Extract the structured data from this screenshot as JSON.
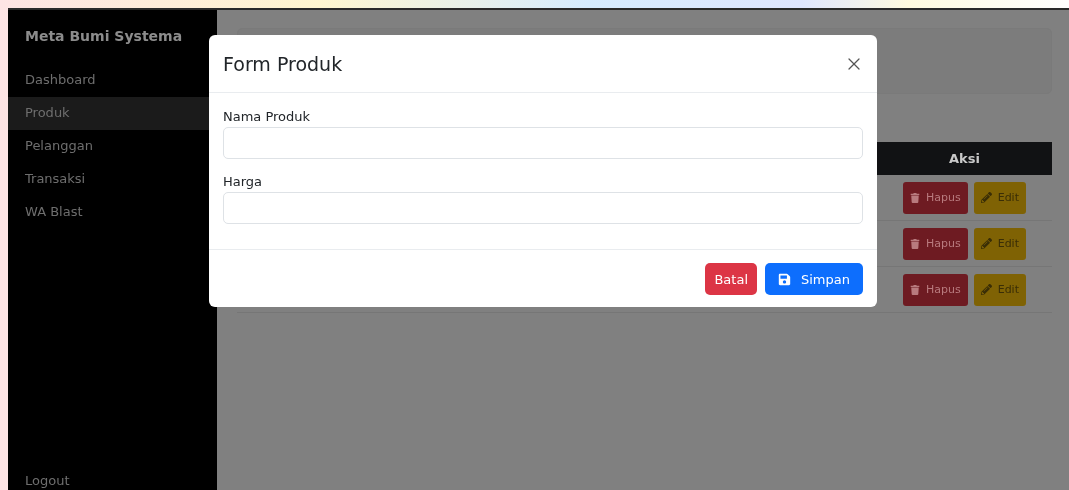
{
  "sidebar": {
    "title": "Meta Bumi Systema",
    "items": [
      {
        "label": "Dashboard",
        "selected": false
      },
      {
        "label": "Produk",
        "selected": true
      },
      {
        "label": "Pelanggan",
        "selected": false
      },
      {
        "label": "Transaksi",
        "selected": false
      },
      {
        "label": "WA Blast",
        "selected": false
      }
    ],
    "logout": "Logout"
  },
  "table": {
    "columns": [
      {
        "label": "Aksi"
      }
    ],
    "rows": [
      {
        "actions": [
          {
            "kind": "delete",
            "label": "Hapus"
          },
          {
            "kind": "edit",
            "label": "Edit"
          }
        ]
      },
      {
        "actions": [
          {
            "kind": "delete",
            "label": "Hapus"
          },
          {
            "kind": "edit",
            "label": "Edit"
          }
        ]
      },
      {
        "actions": [
          {
            "kind": "delete",
            "label": "Hapus"
          },
          {
            "kind": "edit",
            "label": "Edit"
          }
        ]
      }
    ]
  },
  "modal": {
    "title": "Form Produk",
    "fields": [
      {
        "label": "Nama Produk"
      },
      {
        "label": "Harga"
      }
    ],
    "buttons": [
      {
        "kind": "cancel",
        "label": "Batal"
      },
      {
        "kind": "save",
        "label": "Simpan"
      }
    ]
  }
}
